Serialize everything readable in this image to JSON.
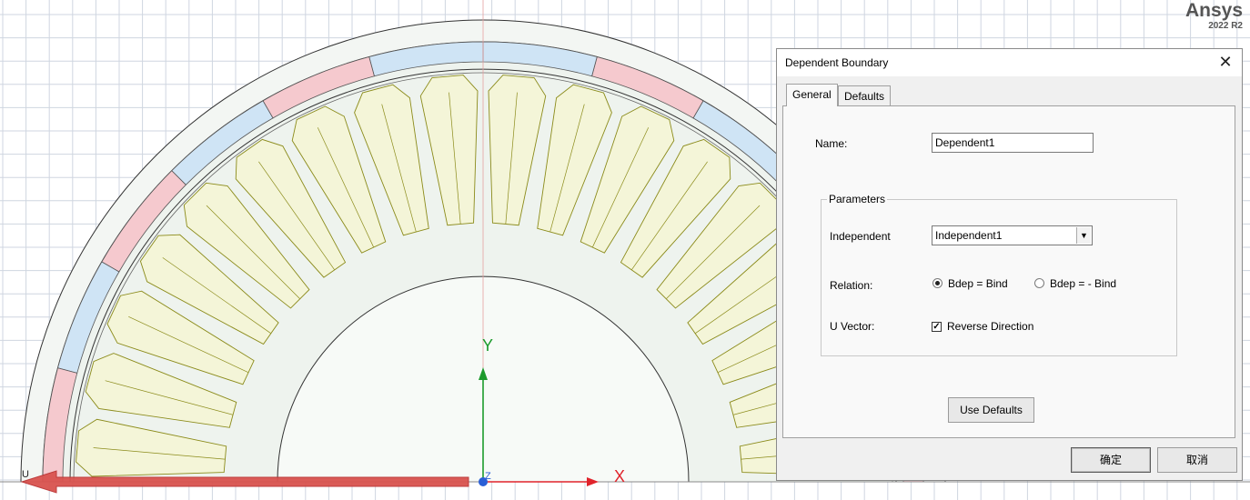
{
  "brand": {
    "name": "Ansys",
    "version": "2022 R2"
  },
  "viewport": {
    "axis_x_label": "X",
    "axis_y_label": "Y",
    "axis_z_label": "Z",
    "u_label": "U",
    "colors": {
      "grid": "#cfd6e0",
      "rotor_fill": "#eef3ee",
      "slot_fill": "#f4f5d8",
      "slot_stroke": "#8b8b1a",
      "band_red": "#f5c9ce",
      "band_blue": "#cfe4f5",
      "u_arrow": "#d9534f",
      "x_axis": "#e0232b",
      "y_axis": "#1c9a2c"
    }
  },
  "dialog": {
    "title": "Dependent Boundary",
    "close_icon": "close-icon",
    "tabs": [
      {
        "label": "General",
        "active": true
      },
      {
        "label": "Defaults",
        "active": false
      }
    ],
    "name_label": "Name:",
    "name_value": "Dependent1",
    "parameters_legend": "Parameters",
    "independent_label": "Independent",
    "independent_value": "Independent1",
    "relation_label": "Relation:",
    "relation_options": [
      {
        "label": "Bdep = Bind",
        "checked": true
      },
      {
        "label": "Bdep = - Bind",
        "checked": false
      }
    ],
    "u_vector_label": "U Vector:",
    "reverse_direction_label": "Reverse Direction",
    "reverse_direction_checked": true,
    "use_defaults_label": "Use Defaults",
    "ok_label": "确定",
    "cancel_label": "取消"
  }
}
